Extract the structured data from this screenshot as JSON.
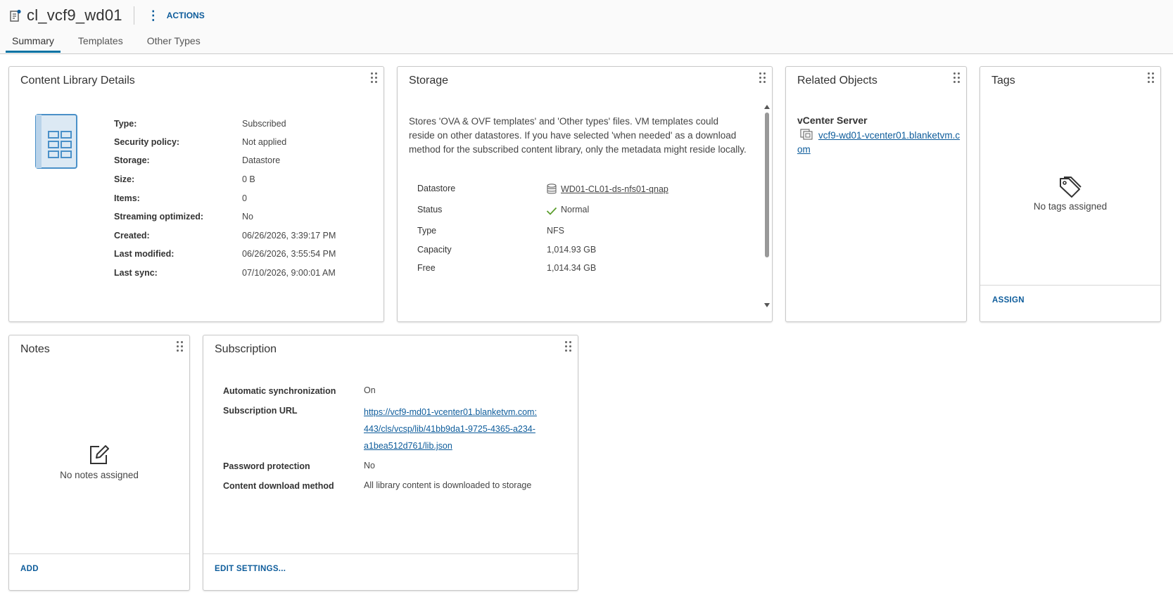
{
  "header": {
    "title": "cl_vcf9_wd01",
    "actions_label": "ACTIONS",
    "tabs": [
      {
        "label": "Summary",
        "active": true
      },
      {
        "label": "Templates",
        "active": false
      },
      {
        "label": "Other Types",
        "active": false
      }
    ]
  },
  "details": {
    "title": "Content Library Details",
    "rows": [
      {
        "label": "Type:",
        "value": "Subscribed"
      },
      {
        "label": "Security policy:",
        "value": "Not applied"
      },
      {
        "label": "Storage:",
        "value": "Datastore"
      },
      {
        "label": "Size:",
        "value": "0 B"
      },
      {
        "label": "Items:",
        "value": "0"
      },
      {
        "label": "Streaming optimized:",
        "value": "No"
      },
      {
        "label": "Created:",
        "value": "06/26/2026, 3:39:17 PM"
      },
      {
        "label": "Last modified:",
        "value": "06/26/2026, 3:55:54 PM"
      },
      {
        "label": "Last sync:",
        "value": "07/10/2026, 9:00:01 AM"
      }
    ]
  },
  "storage": {
    "title": "Storage",
    "description": "Stores 'OVA & OVF templates' and 'Other types' files. VM templates could reside on other datastores. If you have selected 'when needed' as a download method for the subscribed content library, only the metadata might reside locally.",
    "datastore_label": "Datastore",
    "datastore_value": "WD01-CL01-ds-nfs01-qnap",
    "status_label": "Status",
    "status_value": "Normal",
    "type_label": "Type",
    "type_value": "NFS",
    "capacity_label": "Capacity",
    "capacity_value": "1,014.93 GB",
    "free_label": "Free",
    "free_value": "1,014.34 GB"
  },
  "related": {
    "title": "Related Objects",
    "vcenter_label": "vCenter Server",
    "vcenter_link": "vcf9-wd01-vcenter01.blanketvm.com"
  },
  "tags": {
    "title": "Tags",
    "empty_text": "No tags assigned",
    "action_label": "ASSIGN"
  },
  "notes": {
    "title": "Notes",
    "empty_text": "No notes assigned",
    "action_label": "ADD"
  },
  "subscription": {
    "title": "Subscription",
    "auto_sync_label": "Automatic synchronization",
    "auto_sync_value": "On",
    "url_label": "Subscription URL",
    "url_line1": "https://vcf9-md01-vcenter01.blanketvm.com:",
    "url_line2": "443/cls/vcsp/lib/41bb9da1-9725-4365-a234-",
    "url_line3": "a1bea512d761/lib.json",
    "password_label": "Password protection",
    "password_value": "No",
    "download_label": "Content download method",
    "download_value": "All library content is downloaded to storage",
    "action_label": "EDIT SETTINGS..."
  },
  "icons": {
    "title": "content-library-icon",
    "kebab": "vertical-dots-icon",
    "drag": "drag-handle-icon",
    "library": "library-book-icon",
    "datastore": "database-icon",
    "status": "checkmark-icon",
    "vcenter": "vcenter-icon",
    "tag": "tag-icon",
    "note": "edit-note-icon"
  },
  "colors": {
    "link": "#0d5c9b",
    "tab_active": "#0072a3",
    "status_ok": "#5c9e2e",
    "library_icon": "#4a90c8"
  }
}
